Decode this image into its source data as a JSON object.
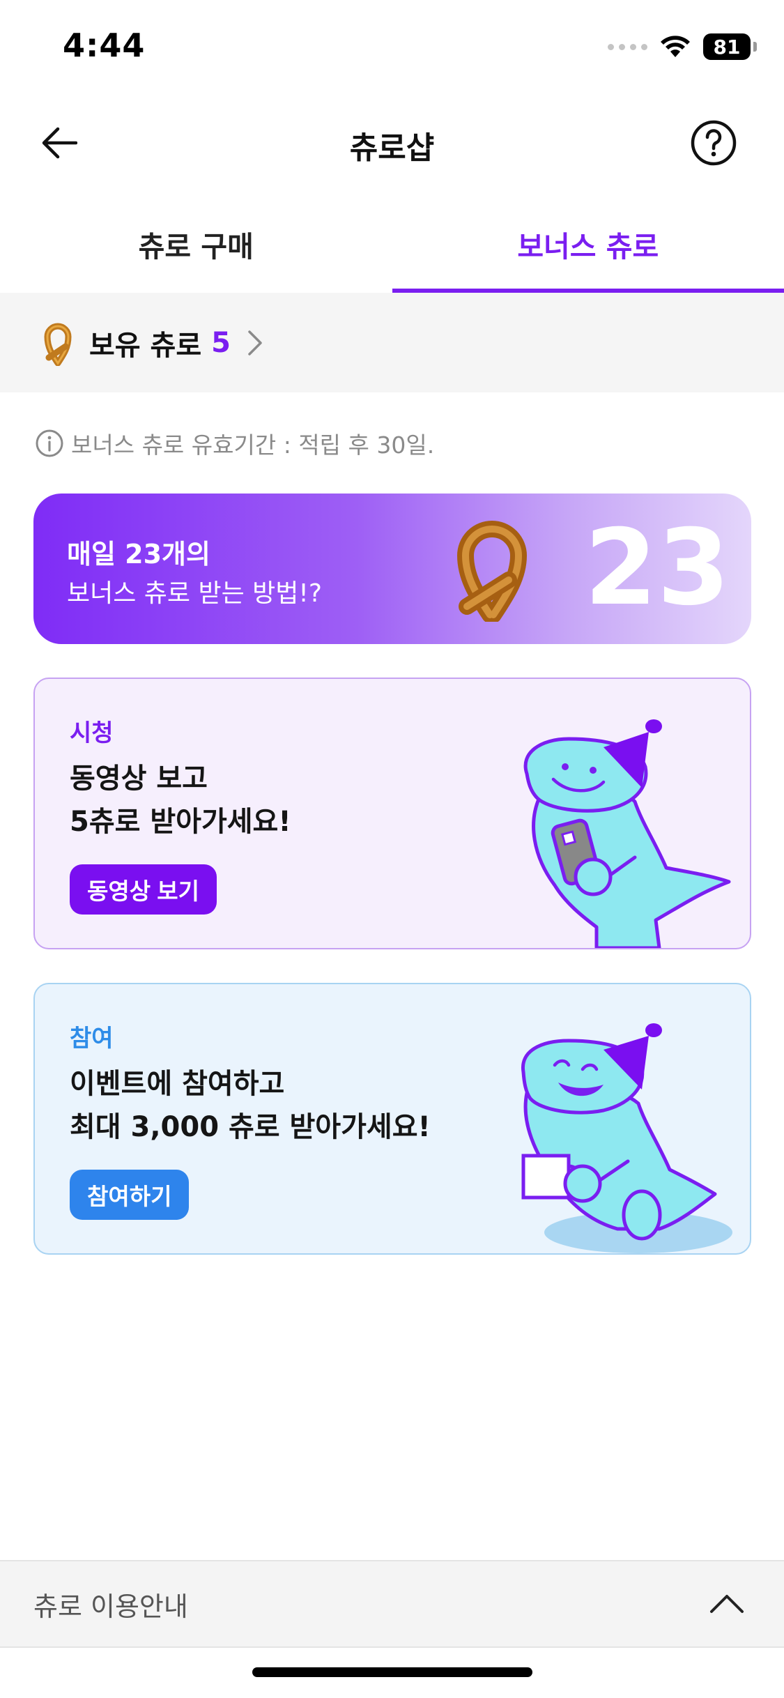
{
  "status_bar": {
    "time": "4:44",
    "battery": "81"
  },
  "header": {
    "title": "츄로샵"
  },
  "tabs": [
    {
      "label": "츄로 구매",
      "active": false
    },
    {
      "label": "보너스 츄로",
      "active": true
    }
  ],
  "balance": {
    "label": "보유 츄로",
    "value": "5"
  },
  "notice": {
    "text": "보너스 츄로 유효기간 : 적립 후 30일."
  },
  "banner": {
    "line1": "매일 23개의",
    "line2": "보너스 츄로 받는 방법!?",
    "number": "23"
  },
  "cards": [
    {
      "category": "시청",
      "title_line1": "동영상 보고",
      "title_line2": "5츄로 받아가세요!",
      "button": "동영상 보기"
    },
    {
      "category": "참여",
      "title_line1": "이벤트에 참여하고",
      "title_line2": "최대 3,000 츄로 받아가세요!",
      "button": "참여하기"
    }
  ],
  "guide": {
    "label": "츄로 이용안내"
  },
  "colors": {
    "accent": "#7a1ef0",
    "blue": "#2e84ec",
    "churro": "#c07a1e"
  }
}
